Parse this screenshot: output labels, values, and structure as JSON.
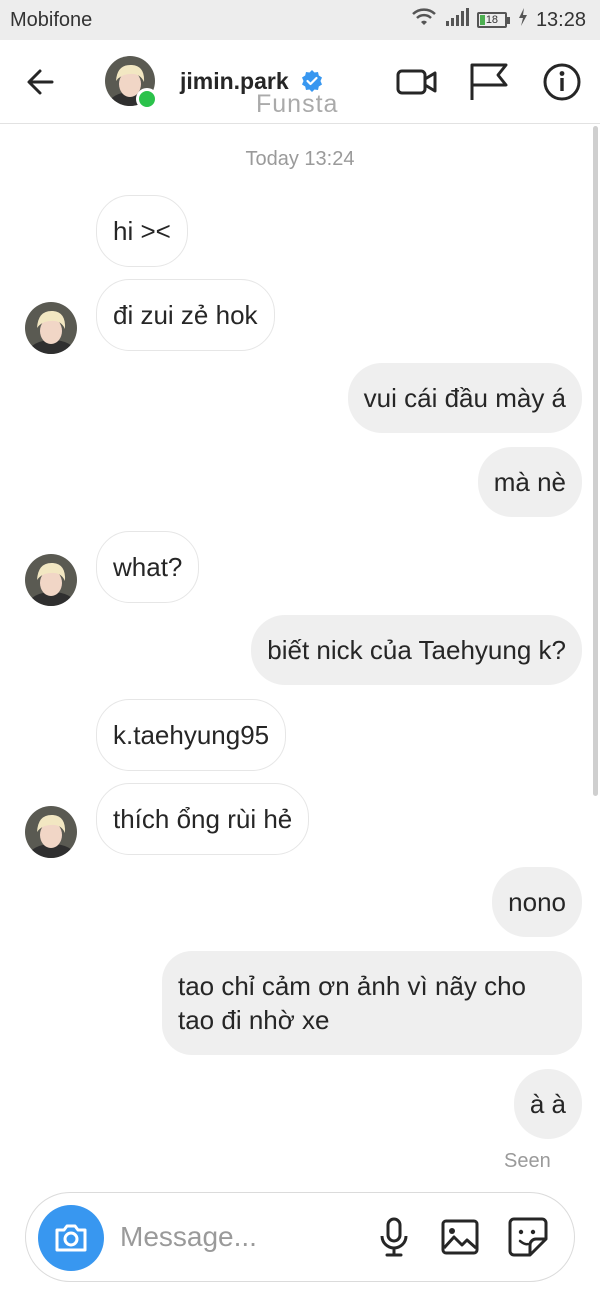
{
  "status_bar": {
    "carrier": "Mobifone",
    "battery": "18",
    "time": "13:28",
    "icons": [
      "wifi-icon",
      "signal-icon",
      "battery-icon",
      "charging-icon"
    ]
  },
  "header": {
    "username": "jimin.park",
    "subtitle": "Funsta",
    "verified": true,
    "online": true,
    "icons": [
      "back-arrow-icon",
      "video-call-icon",
      "flag-icon",
      "info-icon"
    ]
  },
  "chat": {
    "timestamp": "Today 13:24",
    "messages": [
      {
        "dir": "in",
        "text": "hi ><"
      },
      {
        "dir": "in",
        "text": "đi zui zẻ hok"
      },
      {
        "dir": "out",
        "text": "vui cái đầu mày á"
      },
      {
        "dir": "out",
        "text": "mà nè"
      },
      {
        "dir": "in",
        "text": "what?"
      },
      {
        "dir": "out",
        "text": "biết nick của Taehyung k?"
      },
      {
        "dir": "in",
        "text": "k.taehyung95"
      },
      {
        "dir": "in",
        "text": "thích ổng rùi hẻ"
      },
      {
        "dir": "out",
        "text": "nono"
      },
      {
        "dir": "out",
        "text": "tao chỉ cảm ơn ảnh vì nãy cho tao đi nhờ xe"
      },
      {
        "dir": "out",
        "text": "à à"
      }
    ],
    "seen_label": "Seen"
  },
  "composer": {
    "placeholder": "Message...",
    "icons": [
      "camera-icon",
      "microphone-icon",
      "gallery-icon",
      "sticker-icon"
    ]
  },
  "colors": {
    "accent": "#3897f0",
    "online": "#2bc24b",
    "outgoing_bubble": "#efefef",
    "verified": "#3897f0"
  }
}
